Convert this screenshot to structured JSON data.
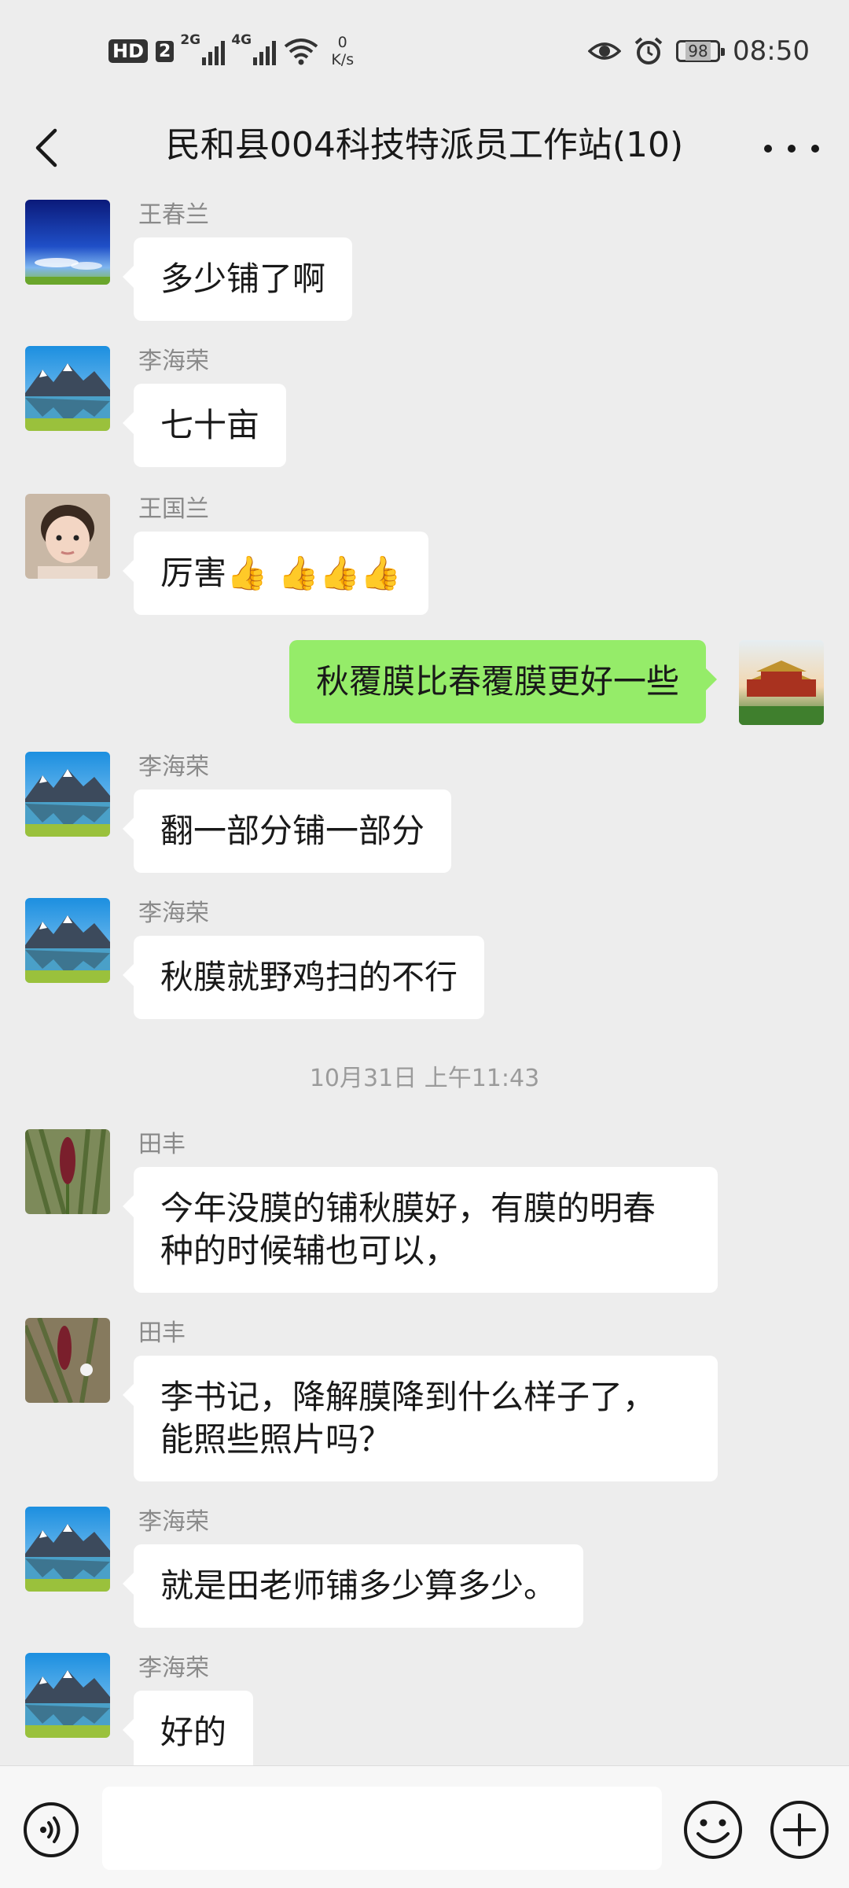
{
  "status_bar": {
    "hd": "HD",
    "sim": "2",
    "signal1_label": "2G",
    "signal2_label": "4G",
    "speed_value": "0",
    "speed_unit": "K/s",
    "battery": "98",
    "time": "08:50"
  },
  "nav": {
    "title": "民和县004科技特派员工作站(10)"
  },
  "messages": [
    {
      "sender": "王春兰",
      "text": "多少铺了啊"
    },
    {
      "sender": "李海荣",
      "text": "七十亩"
    },
    {
      "sender": "王国兰",
      "text": "厉害",
      "emoji": "👍 👍👍👍"
    },
    {
      "sender": "",
      "text": "秋覆膜比春覆膜更好一些"
    },
    {
      "sender": "李海荣",
      "text": "翻一部分铺一部分"
    },
    {
      "sender": "李海荣",
      "text": "秋膜就野鸡扫的不行"
    },
    {
      "sender": "田丰",
      "text_line1": "今年没膜的铺秋膜好，有膜的明春",
      "text_line2": "种的时候辅也可以，"
    },
    {
      "sender": "田丰",
      "text_line1": "李书记，降解膜降到什么样子了，",
      "text_line2": "能照些照片吗？"
    },
    {
      "sender": "李海荣",
      "text": "就是田老师铺多少算多少。"
    },
    {
      "sender": "李海荣",
      "text": "好的"
    }
  ],
  "timestamp": "10月31日 上午11:43",
  "input_bar": {
    "placeholder": ""
  },
  "icons": [
    "back-icon",
    "more-icon",
    "voice-icon",
    "emoji-icon",
    "plus-icon",
    "eye-icon",
    "alarm-icon",
    "wifi-icon"
  ],
  "colors": {
    "background": "#ededed",
    "my_bubble": "#95ec69",
    "other_bubble": "#ffffff"
  }
}
